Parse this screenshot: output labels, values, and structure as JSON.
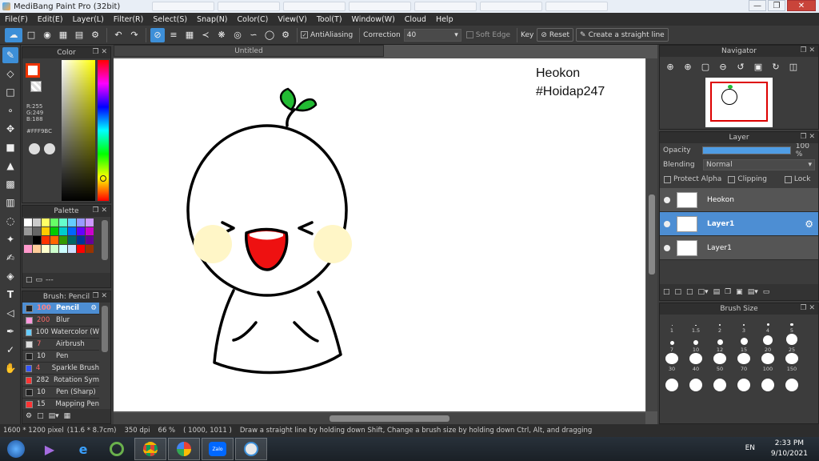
{
  "titlebar": {
    "title": "MediBang Paint Pro (32bit)"
  },
  "menu": [
    "File(F)",
    "Edit(E)",
    "Layer(L)",
    "Filter(R)",
    "Select(S)",
    "Snap(N)",
    "Color(C)",
    "View(V)",
    "Tool(T)",
    "Window(W)",
    "Cloud",
    "Help"
  ],
  "toolbar": {
    "antialias_label": "AntiAliasing",
    "correction_label": "Correction",
    "correction_value": "40",
    "soft_edge_label": "Soft Edge",
    "key_label": "Key",
    "reset_label": "Reset",
    "straight_line_label": "Create a straight line"
  },
  "color_panel": {
    "title": "Color",
    "r": "R:255",
    "g": "G:249",
    "b": "B:188",
    "hex": "#FFF9BC"
  },
  "palette_panel": {
    "title": "Palette",
    "footer": "---",
    "swatches": [
      "#ffffff",
      "#cccccc",
      "#ffff66",
      "#66ff66",
      "#66ffcc",
      "#66ccff",
      "#9999ff",
      "#cc99ff",
      "#999999",
      "#666666",
      "#ffcc00",
      "#00cc00",
      "#00cccc",
      "#0066ff",
      "#6600ff",
      "#cc00cc",
      "#333333",
      "#000000",
      "#ff3300",
      "#ff6600",
      "#339900",
      "#006666",
      "#003399",
      "#660099",
      "#ff99cc",
      "#ffcc99",
      "#ffffcc",
      "#ccffcc",
      "#ccffff",
      "#cce0ff",
      "#ff0000",
      "#993300"
    ]
  },
  "brush_panel": {
    "title": "Brush: Pencil",
    "items": [
      {
        "size": "100",
        "name": "Pencil",
        "color": "#222222"
      },
      {
        "size": "200",
        "name": "Blur",
        "color": "#ff99dd"
      },
      {
        "size": "100",
        "name": "Watercolor (W",
        "color": "#66ccff"
      },
      {
        "size": "7",
        "name": "Airbrush",
        "color": "#dddddd"
      },
      {
        "size": "10",
        "name": "Pen",
        "color": "#222222"
      },
      {
        "size": "4",
        "name": "Sparkle Brush",
        "color": "#3355ff"
      },
      {
        "size": "282",
        "name": "Rotation Sym",
        "color": "#ff3333"
      },
      {
        "size": "10",
        "name": "Pen (Sharp)",
        "color": "#222222"
      },
      {
        "size": "15",
        "name": "Mapping Pen",
        "color": "#ff3333"
      }
    ]
  },
  "document": {
    "tab_title": "Untitled",
    "text_line1": "Heokon",
    "text_line2": "#Hoidap247",
    "colors": {
      "sprout": "#22bb33",
      "cheek": "#fff6c7",
      "mouth": "#ee1111"
    }
  },
  "navigator": {
    "title": "Navigator"
  },
  "layer_panel": {
    "title": "Layer",
    "opacity_label": "Opacity",
    "opacity_value": "100 %",
    "opacity_fraction": 1.0,
    "blending_label": "Blending",
    "blending_value": "Normal",
    "protect_alpha": "Protect Alpha",
    "clipping": "Clipping",
    "lock": "Lock",
    "layers": [
      {
        "name": "Heokon",
        "selected": false
      },
      {
        "name": "Layer1",
        "selected": true
      },
      {
        "name": "Layer1",
        "selected": false
      }
    ]
  },
  "brush_size_panel": {
    "title": "Brush Size",
    "sizes": [
      "1",
      "1.5",
      "2",
      "3",
      "4",
      "5",
      "7",
      "10",
      "12",
      "15",
      "20",
      "25",
      "30",
      "40",
      "50",
      "70",
      "100",
      "150"
    ]
  },
  "status": {
    "size": "1600 * 1200 pixel",
    "cm": "(11.6 * 8.7cm)",
    "dpi": "350 dpi",
    "zoom": "66 %",
    "coords": "( 1000, 1011 )",
    "hint": "Draw a straight line by holding down Shift, Change a brush size by holding down Ctrl, Alt, and dragging"
  },
  "taskbar": {
    "lang": "EN",
    "time": "2:33 PM",
    "date": "9/10/2021",
    "zalo": "Zalo"
  }
}
